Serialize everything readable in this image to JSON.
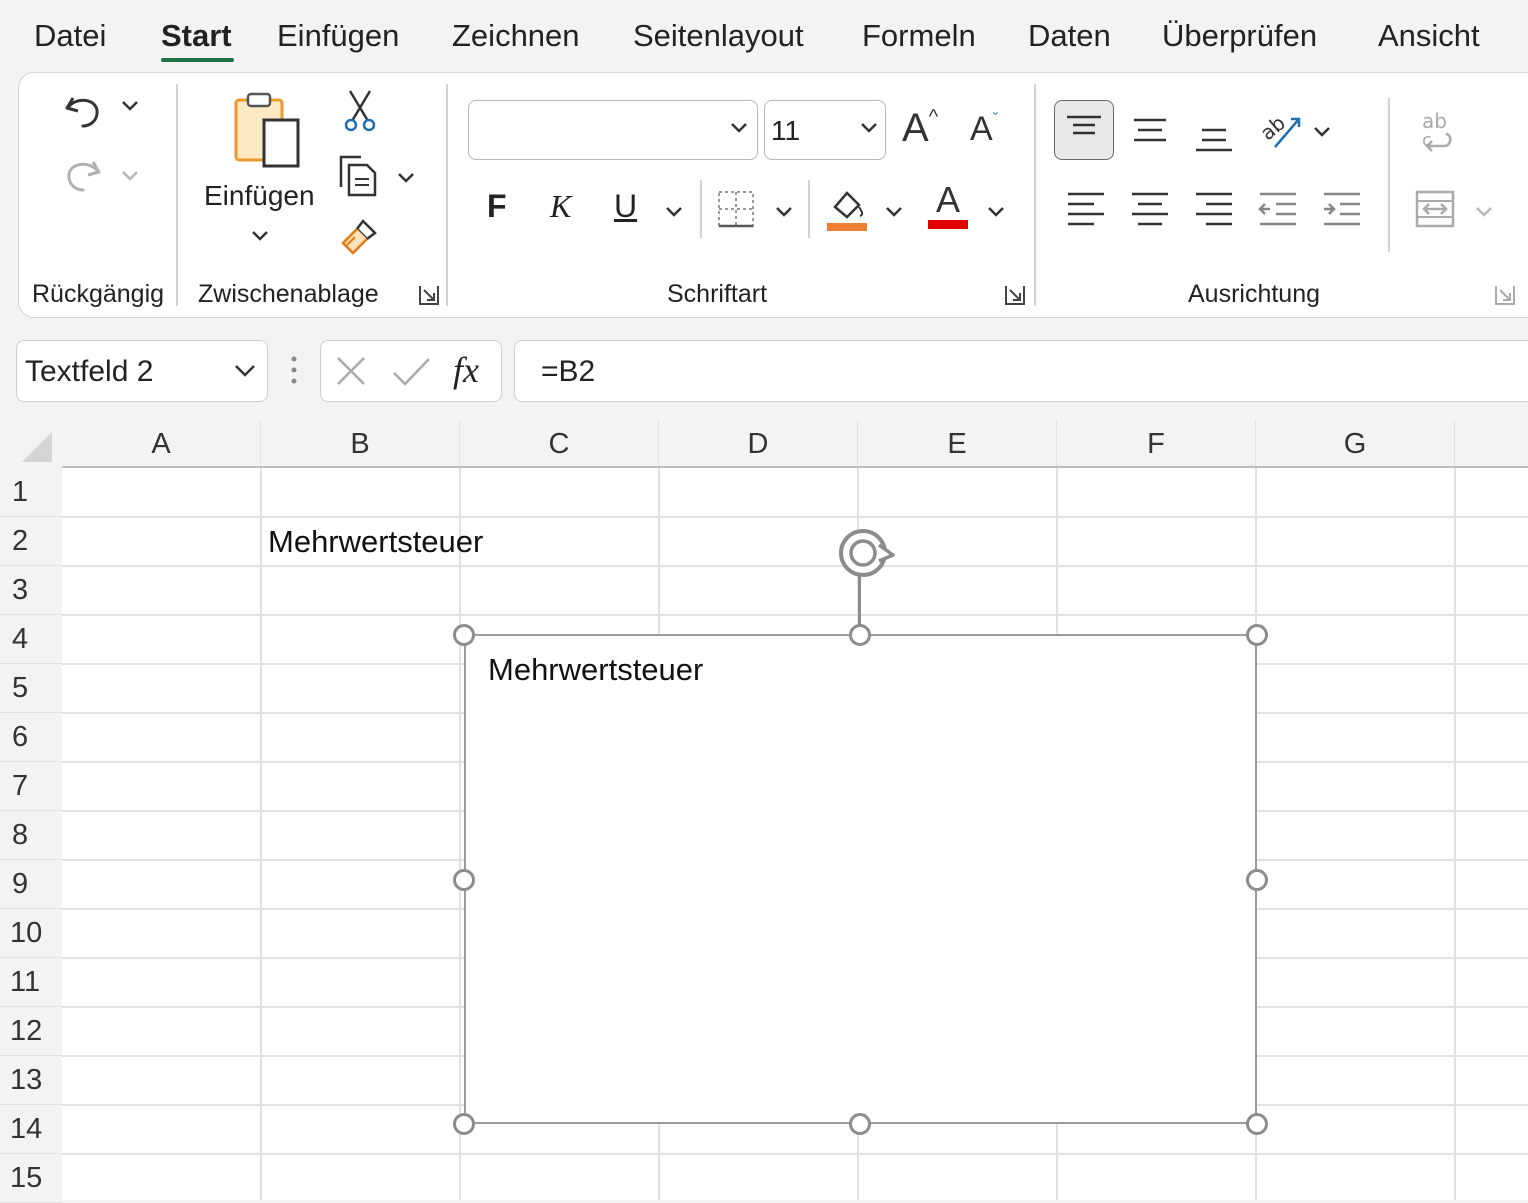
{
  "menu": {
    "tabs": [
      {
        "label": "Datei"
      },
      {
        "label": "Start"
      },
      {
        "label": "Einfügen"
      },
      {
        "label": "Zeichnen"
      },
      {
        "label": "Seitenlayout"
      },
      {
        "label": "Formeln"
      },
      {
        "label": "Daten"
      },
      {
        "label": "Überprüfen"
      },
      {
        "label": "Ansicht"
      }
    ],
    "active_tab": "Start"
  },
  "ribbon": {
    "groups": {
      "undo": {
        "label": "Rückgängig"
      },
      "clipboard": {
        "label": "Zwischenablage",
        "paste_label": "Einfügen"
      },
      "font": {
        "label": "Schriftart",
        "font_name": "",
        "font_size": "11",
        "bold_label": "F",
        "italic_label": "K",
        "underline_label": "U",
        "font_color_letter": "A",
        "grow_letter": "A",
        "shrink_letter": "A"
      },
      "alignment": {
        "label": "Ausrichtung"
      }
    },
    "colors": {
      "fill_color": "#ed7d31",
      "font_color": "#e00000",
      "accent": "#1e7145"
    }
  },
  "formula_bar": {
    "name_box": "Textfeld 2",
    "fx_label": "fx",
    "formula": "=B2"
  },
  "sheet": {
    "columns": [
      "A",
      "B",
      "C",
      "D",
      "E",
      "F",
      "G"
    ],
    "rows": [
      "1",
      "2",
      "3",
      "4",
      "5",
      "6",
      "7",
      "8",
      "9",
      "10",
      "11",
      "12",
      "13",
      "14",
      "15"
    ],
    "cells": {
      "B2": "Mehrwertsteuer"
    },
    "textbox": {
      "name": "Textfeld 2",
      "text": "Mehrwertsteuer"
    }
  }
}
